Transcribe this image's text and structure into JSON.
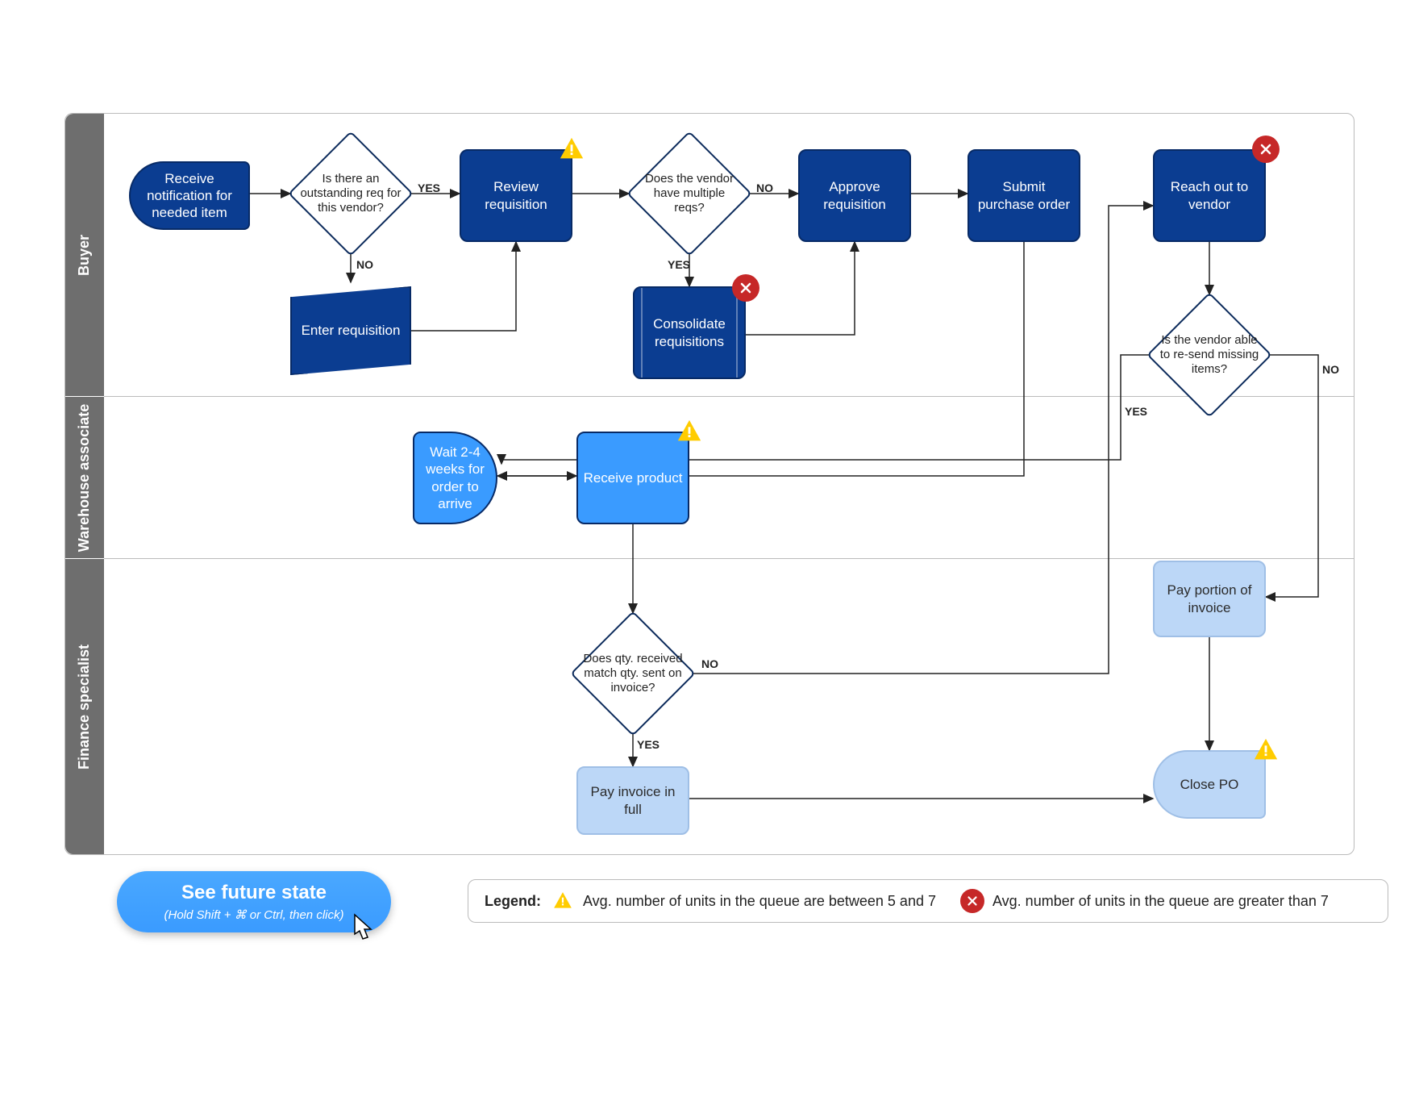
{
  "lanes": {
    "buyer": "Buyer",
    "warehouse": "Warehouse associate",
    "finance": "Finance specialist"
  },
  "nodes": {
    "receive_notification": "Receive notification for needed item",
    "outstanding_req": "Is there an outstanding req for this vendor?",
    "review_requisition": "Review requisition",
    "enter_requisition": "Enter requisition",
    "multiple_reqs": "Does the vendor have multiple reqs?",
    "consolidate": "Consolidate requisitions",
    "approve_requisition": "Approve requisition",
    "submit_po": "Submit purchase order",
    "reach_out_vendor": "Reach out to vendor",
    "vendor_resend": "Is the vendor able to re-send missing items?",
    "wait_weeks": "Wait 2-4 weeks for order to arrive",
    "receive_product": "Receive product",
    "qty_match": "Does qty. received match qty. sent on invoice?",
    "pay_full": "Pay invoice in full",
    "pay_portion": "Pay portion of invoice",
    "close_po": "Close PO"
  },
  "labels": {
    "yes": "YES",
    "no": "NO"
  },
  "button": {
    "title": "See future state",
    "subtitle": "(Hold Shift + ⌘ or Ctrl, then click)"
  },
  "legend": {
    "title": "Legend:",
    "warn": "Avg. number of units in the queue are between 5 and  7",
    "err": "Avg. number of units in the queue are greater than 7"
  },
  "badges": {
    "review_requisition": "warn",
    "consolidate": "err",
    "reach_out_vendor": "err",
    "receive_product": "warn",
    "close_po": "warn"
  }
}
